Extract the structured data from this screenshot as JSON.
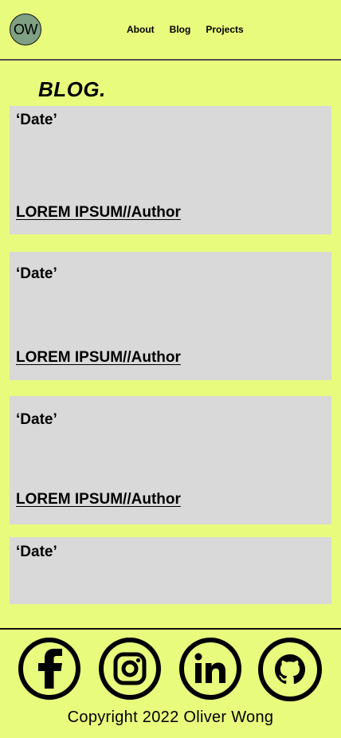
{
  "header": {
    "logo_text": "OW",
    "nav": [
      {
        "label": "About"
      },
      {
        "label": "Blog"
      },
      {
        "label": "Projects"
      }
    ]
  },
  "page_title": "BLOG.",
  "posts": [
    {
      "date": "‘Date’",
      "link": "LOREM IPSUM//Author"
    },
    {
      "date": "‘Date’",
      "link": "LOREM IPSUM//Author"
    },
    {
      "date": "‘Date’",
      "link": "LOREM IPSUM//Author"
    },
    {
      "date": "‘Date’"
    }
  ],
  "footer": {
    "social": [
      {
        "icon": "facebook-icon"
      },
      {
        "icon": "instagram-icon"
      },
      {
        "icon": "linkedin-icon"
      },
      {
        "icon": "github-icon"
      }
    ],
    "copyright": "Copyright 2022 Oliver Wong"
  },
  "colors": {
    "background": "#e8fb7d",
    "card": "#d9d9d9",
    "logo": "#7fa083"
  }
}
